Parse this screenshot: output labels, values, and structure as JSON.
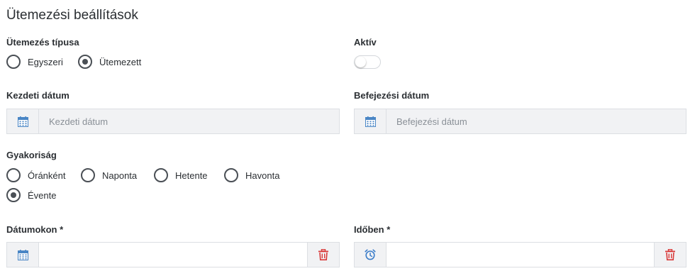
{
  "page": {
    "title": "Ütemezési beállítások"
  },
  "schedule_type": {
    "label": "Ütemezés típusa",
    "options": [
      {
        "label": "Egyszeri",
        "checked": false
      },
      {
        "label": "Ütemezett",
        "checked": true
      }
    ]
  },
  "active": {
    "label": "Aktív",
    "value": false
  },
  "start_date": {
    "label": "Kezdeti dátum",
    "placeholder": "Kezdeti dátum",
    "value": ""
  },
  "end_date": {
    "label": "Befejezési dátum",
    "placeholder": "Befejezési dátum",
    "value": ""
  },
  "frequency": {
    "label": "Gyakoriság",
    "options": [
      {
        "label": "Óránként",
        "checked": false
      },
      {
        "label": "Naponta",
        "checked": false
      },
      {
        "label": "Hetente",
        "checked": false
      },
      {
        "label": "Havonta",
        "checked": false
      },
      {
        "label": "Évente",
        "checked": true
      }
    ]
  },
  "dates": {
    "label": "Dátumokon *",
    "value": ""
  },
  "times": {
    "label": "Időben *",
    "value": ""
  },
  "colors": {
    "calendar_icon": "#4a86c5",
    "clock_icon": "#3b7dc9",
    "trash_icon": "#d93a3a",
    "addon_bg": "#f1f2f4",
    "border": "#dcdfe3"
  }
}
